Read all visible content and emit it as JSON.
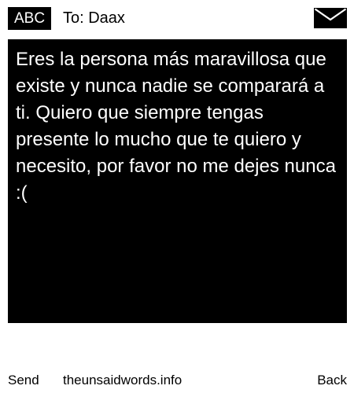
{
  "header": {
    "mode": "ABC",
    "recipient": "To: Daax",
    "icon": "envelope-icon"
  },
  "message": {
    "body": "Eres la persona más maravillosa que existe y nunca nadie se comparará a ti. Quiero que siempre tengas presente lo mucho que te quiero y necesito, por favor no me dejes nunca :("
  },
  "softkeys": {
    "left": "Send",
    "center": "theunsaidwords.info",
    "right": "Back"
  }
}
